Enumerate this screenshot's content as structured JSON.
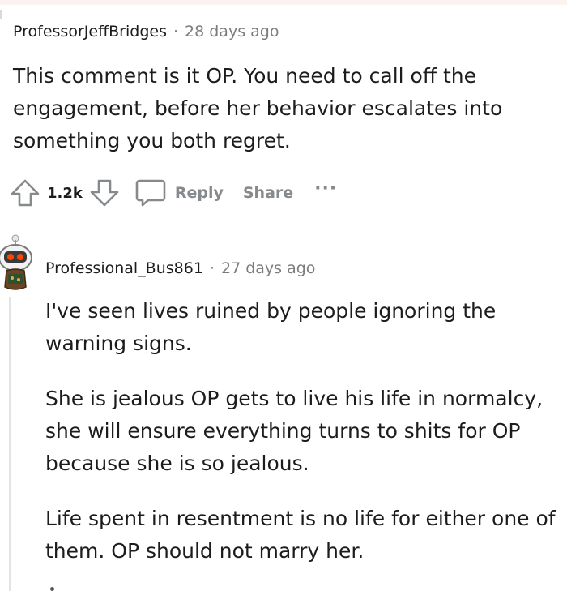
{
  "comment1": {
    "author": "ProfessorJeffBridges",
    "separator": "·",
    "time": "28 days ago",
    "paragraphs": [
      "This comment is it OP. You need to call off the engagement, before her behavior escalates into something you both regret."
    ],
    "votes": "1.2k",
    "reply_label": "Reply",
    "share_label": "Share",
    "more_label": "···"
  },
  "comment2": {
    "author": "Professional_Bus861",
    "separator": "·",
    "time": "27 days ago",
    "paragraphs": [
      "I've seen lives ruined by people ignoring the warning signs.",
      "She is jealous OP gets to live his life in normalcy, she will ensure everything turns to shits for OP because she is so jealous.",
      "Life spent in resentment is no life for either one of them. OP should not marry her."
    ]
  },
  "icons": {
    "upvote": "arrow-up-icon",
    "downvote": "arrow-down-icon",
    "reply": "speech-bubble-icon",
    "avatar": "snoo-avatar"
  },
  "colors": {
    "text": "#1c1c1c",
    "meta": "#7c7c7c",
    "action": "#878a8c"
  }
}
